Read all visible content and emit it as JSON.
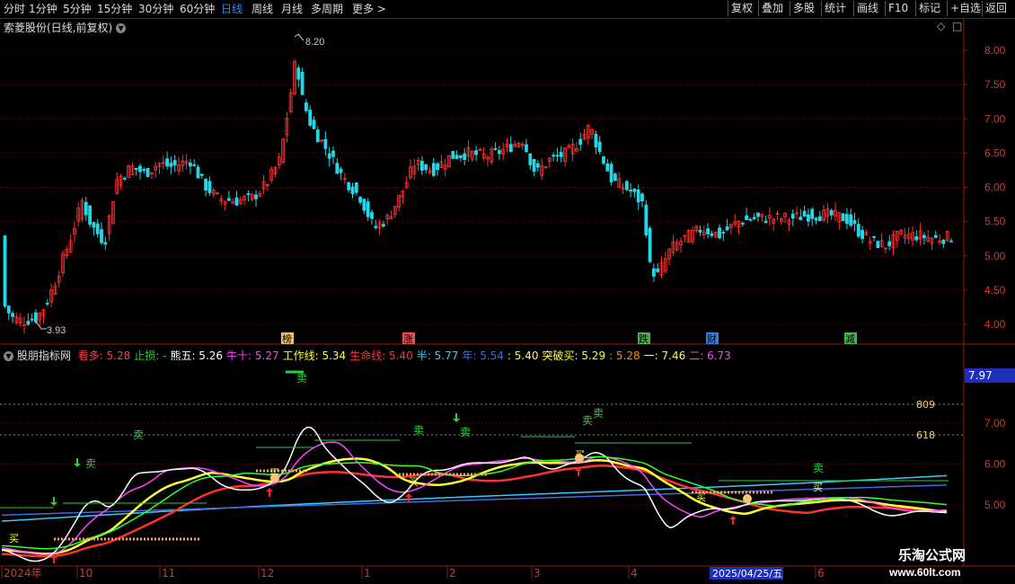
{
  "toolbar": {
    "periods": [
      "分时",
      "1分钟",
      "5分钟",
      "15分钟",
      "30分钟",
      "60分钟",
      "日线",
      "周线",
      "月线",
      "多周期",
      "更多 >"
    ],
    "active_period": "日线",
    "buttons": [
      "复权",
      "叠加",
      "多股",
      "统计",
      "画线",
      "F10",
      "标记",
      "+自选",
      "返回"
    ]
  },
  "main_chart": {
    "title": "索菱股份(日线,前复权)",
    "high_label": "8.20",
    "low_label": "3.93",
    "y_ticks": [
      "8.00",
      "7.50",
      "7.00",
      "6.50",
      "6.00",
      "5.50",
      "5.00",
      "4.50",
      "4.00"
    ],
    "y_tick_values": [
      8.0,
      7.5,
      7.0,
      6.5,
      6.0,
      5.5,
      5.0,
      4.5,
      4.0
    ],
    "badges": [
      {
        "text": "榜",
        "color": "#e8c26a"
      },
      {
        "text": "涨",
        "color": "#e85050"
      },
      {
        "text": "跌",
        "color": "#4caf50"
      },
      {
        "text": "财",
        "color": "#3a7bd5"
      },
      {
        "text": "减",
        "color": "#4caf50"
      }
    ],
    "colors": {
      "up": "#ff3030",
      "down": "#22d8e8"
    }
  },
  "indicator": {
    "name": "股朋指标网",
    "legend": [
      {
        "label": "看多:",
        "value": "5.28",
        "color": "#ff4040"
      },
      {
        "label": "止损:",
        "value": "-",
        "color": "#33cc33"
      },
      {
        "label": "熊五:",
        "value": "5.26",
        "color": "#ffffff"
      },
      {
        "label": "牛十:",
        "value": "5.27",
        "color": "#ff44ff"
      },
      {
        "label": "工作线:",
        "value": "5.34",
        "color": "#ffff33"
      },
      {
        "label": "生命线:",
        "value": "5.40",
        "color": "#ff3030"
      },
      {
        "label": "半:",
        "value": "5.77",
        "color": "#33ccff"
      },
      {
        "label": "年:",
        "value": "5.54",
        "color": "#4169e1"
      },
      {
        "label": ":",
        "value": "5.40",
        "color": "#ffff33"
      },
      {
        "label": "突破买:",
        "value": "5.29",
        "color": "#ffff33"
      },
      {
        "label": ":",
        "value": "5.28",
        "color": "#ff8800"
      },
      {
        "label": "一:",
        "value": "7.46",
        "color": "#ffff33"
      },
      {
        "label": "二:",
        "value": "6.73",
        "color": "#ff44ff"
      }
    ],
    "current_value": "7.97",
    "y_ticks": [
      "7.00",
      "6.00",
      "5.00"
    ],
    "fib_labels": [
      "809",
      "618"
    ],
    "sell_label": "卖",
    "buy_label": "买",
    "sell_marks": 9
  },
  "x_axis": {
    "labels": [
      "2024年",
      "10",
      "11",
      "12",
      "1",
      "2",
      "3",
      "4",
      "6"
    ],
    "cursor_date": "2025/04/25/五"
  },
  "watermark": {
    "line1": "乐淘公式网",
    "line2": "www.60lt.com"
  }
}
